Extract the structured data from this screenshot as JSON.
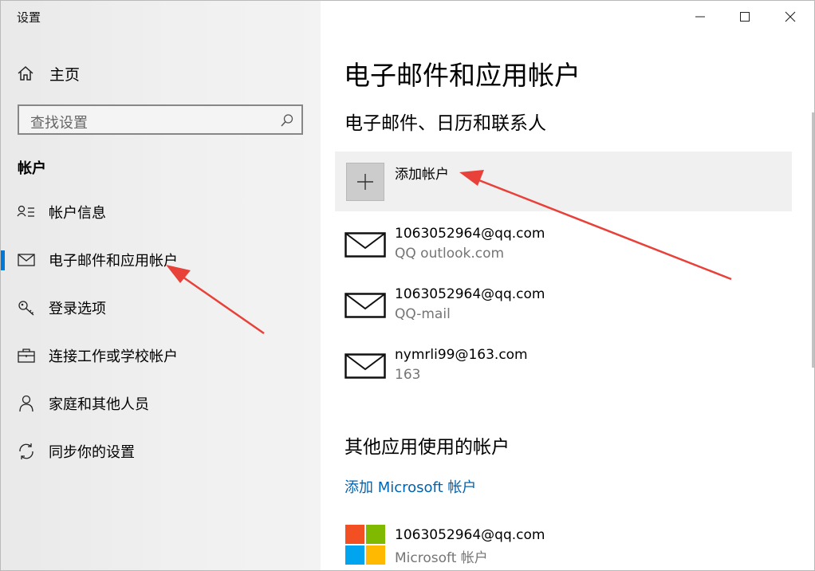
{
  "window": {
    "title": "设置"
  },
  "sidebar": {
    "home_label": "主页",
    "search_placeholder": "查找设置",
    "section_title": "帐户",
    "items": [
      {
        "label": "帐户信息",
        "icon": "account-info-icon"
      },
      {
        "label": "电子邮件和应用帐户",
        "icon": "mail-icon",
        "active": true
      },
      {
        "label": "登录选项",
        "icon": "key-icon"
      },
      {
        "label": "连接工作或学校帐户",
        "icon": "briefcase-icon"
      },
      {
        "label": "家庭和其他人员",
        "icon": "person-icon"
      },
      {
        "label": "同步你的设置",
        "icon": "sync-icon"
      }
    ]
  },
  "main": {
    "page_title": "电子邮件和应用帐户",
    "email_section_title": "电子邮件、日历和联系人",
    "add_account_label": "添加帐户",
    "email_accounts": [
      {
        "email": "1063052964@qq.com",
        "provider": "QQ outlook.com"
      },
      {
        "email": "1063052964@qq.com",
        "provider": "QQ-mail"
      },
      {
        "email": "nymrli99@163.com",
        "provider": "163"
      }
    ],
    "other_section_title": "其他应用使用的帐户",
    "add_ms_account_link": "添加 Microsoft 帐户",
    "ms_account": {
      "email": "1063052964@qq.com",
      "type": "Microsoft 帐户"
    }
  },
  "colors": {
    "accent": "#0078d7",
    "link": "#0063b1",
    "annotation_arrow": "#e8413a",
    "ms_red": "#f25022",
    "ms_green": "#7fba00",
    "ms_blue": "#00a4ef",
    "ms_yellow": "#ffb900"
  }
}
